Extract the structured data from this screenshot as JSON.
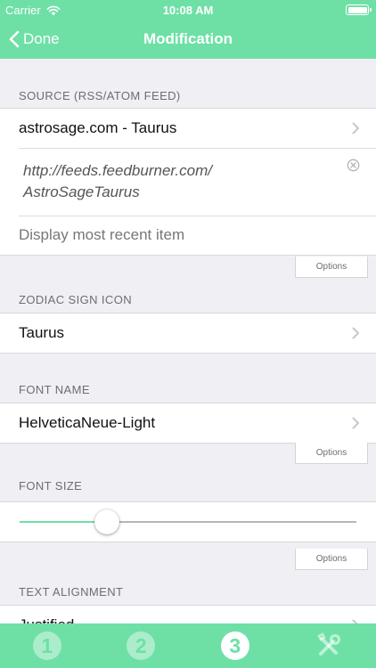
{
  "status_bar": {
    "carrier": "Carrier",
    "time": "10:08 AM"
  },
  "nav": {
    "back_label": "Done",
    "title": "Modification"
  },
  "source": {
    "header": "SOURCE (RSS/ATOM FEED)",
    "feed_name": "astrosage.com - Taurus",
    "url_line1": "http://feeds.feedburner.com/",
    "url_line2": "AstroSageTaurus",
    "display_mode": "Display most recent item",
    "options_label": "Options"
  },
  "zodiac": {
    "header": "ZODIAC SIGN ICON",
    "value": "Taurus"
  },
  "font_name": {
    "header": "FONT NAME",
    "value": "HelveticaNeue-Light",
    "options_label": "Options"
  },
  "font_size": {
    "header": "FONT SIZE",
    "slider_value": 0.26,
    "options_label": "Options"
  },
  "text_alignment": {
    "header": "TEXT ALIGNMENT",
    "value": "Justified"
  },
  "tabs": [
    {
      "label": "1",
      "active": false
    },
    {
      "label": "2",
      "active": false
    },
    {
      "label": "3",
      "active": true
    },
    {
      "label": "tools",
      "active": false
    }
  ],
  "colors": {
    "accent": "#6ee0a6",
    "background": "#efeff4",
    "section_text": "#6d6d72"
  }
}
